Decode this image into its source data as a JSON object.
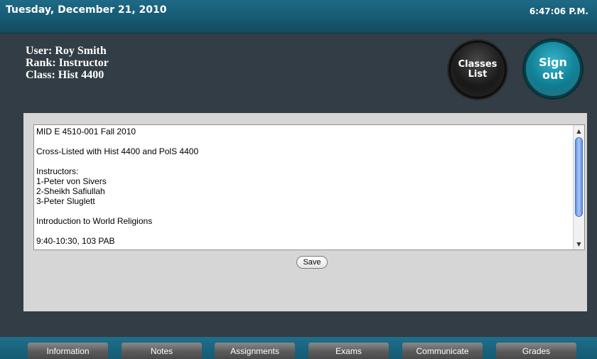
{
  "header": {
    "date": "Tuesday, December 21, 2010",
    "time": "6:47:06 P.M."
  },
  "user": {
    "name_line": "User: Roy Smith",
    "rank_line": "Rank: Instructor",
    "class_line": "Class: Hist 4400"
  },
  "buttons": {
    "classes_list": "Classes\nList",
    "sign_out": "Sign\nout",
    "save": "Save"
  },
  "notes": {
    "lines": [
      "MID E 4510-001  Fall 2010",
      "",
      "Cross-Listed with Hist 4400 and PolS 4400",
      "",
      "Instructors:",
      "1-Peter von Sivers",
      "2-Sheikh Safiullah",
      "3-Peter Sluglett",
      "",
      "Introduction to World Religions",
      "",
      "9:40-10:30, 103 PAB"
    ]
  },
  "tabs": [
    "Information",
    "Notes",
    "Assignments",
    "Exams",
    "Communicate",
    "Grades"
  ],
  "colors": {
    "header": "#175a73",
    "background": "#323d45",
    "sign_out_button": "#0f7f95",
    "classes_button": "#1a1a1a"
  },
  "icons": {
    "scroll_up": "scroll-up-arrow-icon",
    "scroll_down": "scroll-down-arrow-icon"
  }
}
